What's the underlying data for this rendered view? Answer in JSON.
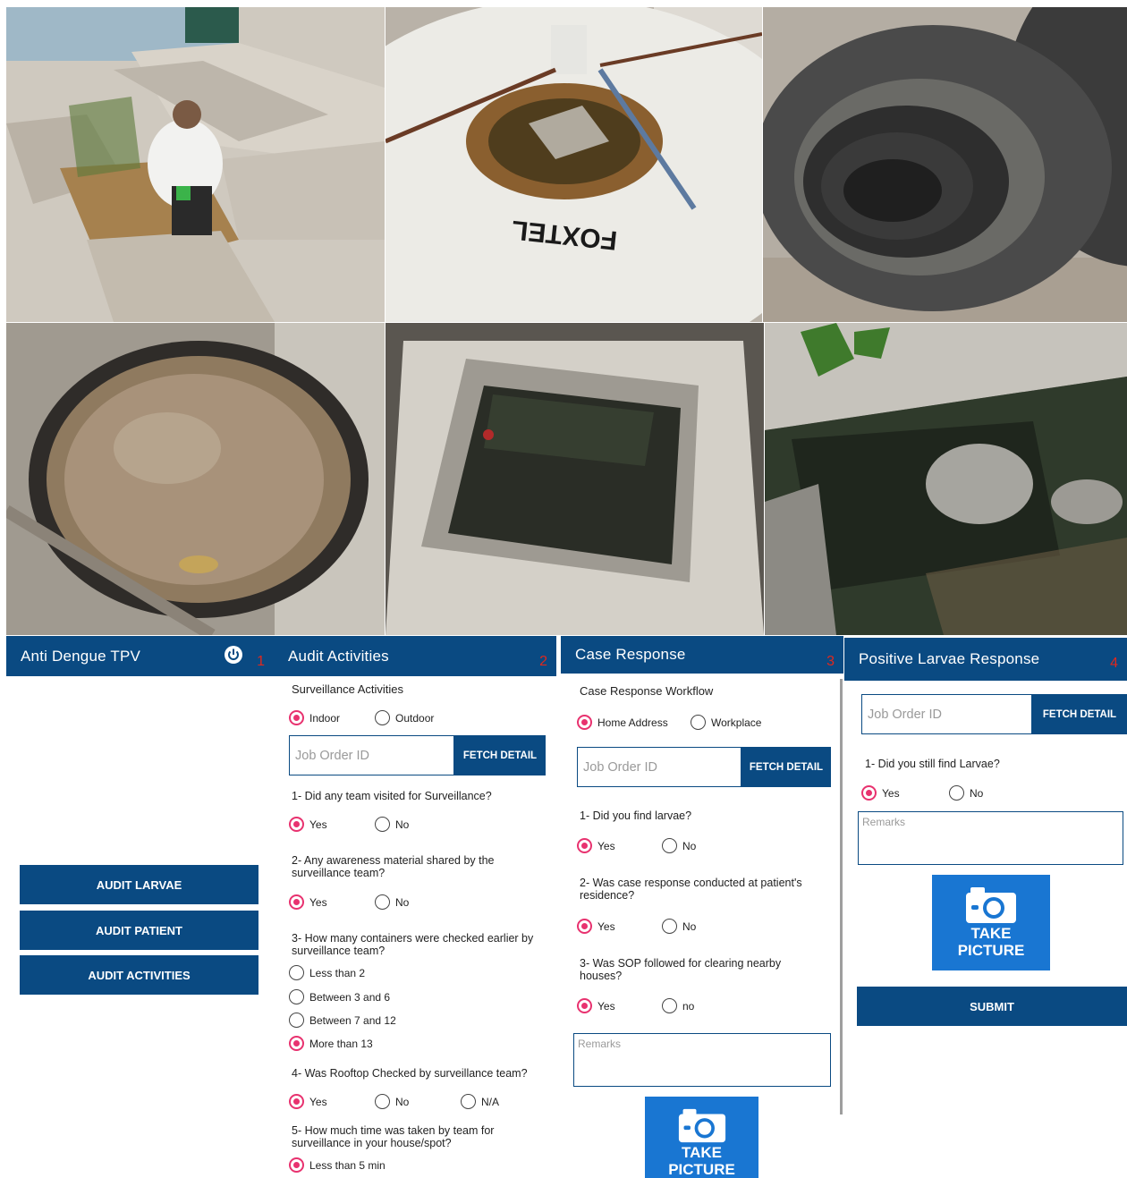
{
  "photos": {
    "p1_caption": "",
    "p2_dish_text": "FOXTEL"
  },
  "panel1": {
    "title": "Anti Dengue TPV",
    "number": "1",
    "power_icon": "power-icon",
    "buttons": [
      "AUDIT LARVAE",
      "AUDIT PATIENT",
      "AUDIT ACTIVITIES"
    ]
  },
  "panel2": {
    "title": "Audit Activities",
    "number": "2",
    "section": "Surveillance Activities",
    "location_options": [
      "Indoor",
      "Outdoor"
    ],
    "location_selected": "Indoor",
    "job_placeholder": "Job Order ID",
    "fetch_label": "FETCH DETAIL",
    "q1": "1- Did any team visited for Surveillance?",
    "q1_options": [
      "Yes",
      "No"
    ],
    "q2": "2- Any awareness material shared by the surveillance team?",
    "q2_options": [
      "Yes",
      "No"
    ],
    "q3": "3- How many containers were checked earlier by surveillance team?",
    "q3_options": [
      "Less than 2",
      "Between 3 and 6",
      "Between 7 and 12",
      "More than 13"
    ],
    "q3_selected": "More than 13",
    "q4": "4- Was Rooftop Checked by surveillance team?",
    "q4_options": [
      "Yes",
      "No",
      "N/A"
    ],
    "q5": "5- How much time was taken by team for surveillance in your house/spot?",
    "q5_options": [
      "Less than 5 min"
    ]
  },
  "panel3": {
    "title": "Case Response",
    "number": "3",
    "section": "Case Response Workflow",
    "location_options": [
      "Home Address",
      "Workplace"
    ],
    "job_placeholder": "Job Order ID",
    "fetch_label": "FETCH DETAIL",
    "q1": "1- Did you find larvae?",
    "q1_options": [
      "Yes",
      "No"
    ],
    "q2": "2- Was case response conducted at patient's residence?",
    "q2_options": [
      "Yes",
      "No"
    ],
    "q3": "3- Was SOP followed for clearing nearby houses?",
    "q3_options": [
      "Yes",
      "no"
    ],
    "remarks_placeholder": "Remarks",
    "take_picture": [
      "TAKE",
      "PICTURE"
    ]
  },
  "panel4": {
    "title": "Positive Larvae Response",
    "number": "4",
    "job_placeholder": "Job Order ID",
    "fetch_label": "FETCH DETAIL",
    "q1": "1- Did you still find Larvae?",
    "q1_options": [
      "Yes",
      "No"
    ],
    "remarks_placeholder": "Remarks",
    "take_picture": [
      "TAKE",
      "PICTURE"
    ],
    "submit": "SUBMIT"
  },
  "colors": {
    "appbar": "#0a4a82",
    "radio_on": "#e8326f",
    "camera_button": "#1976d2",
    "panel_number": "#e0281d"
  }
}
